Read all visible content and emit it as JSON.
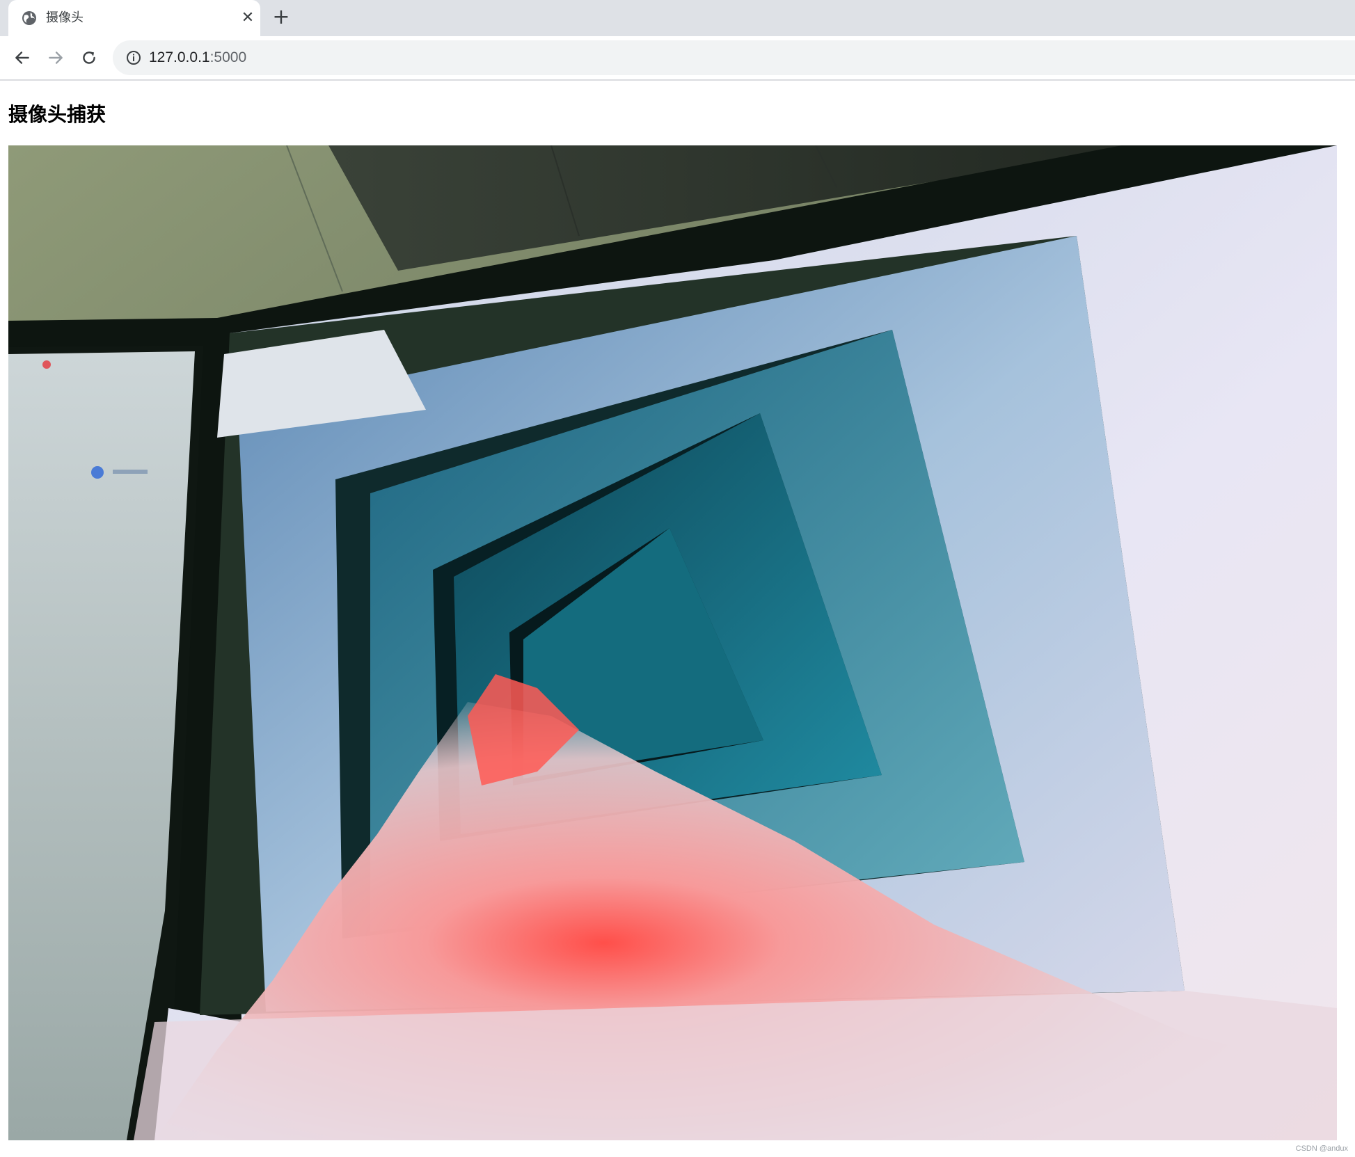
{
  "browser": {
    "tab": {
      "title": "摄像头",
      "close_glyph": "✕",
      "favicon": "globe-icon"
    },
    "new_tab_glyph": "+",
    "address": {
      "host": "127.0.0.1",
      "port": ":5000",
      "icon": "info-icon"
    }
  },
  "page": {
    "heading": "摄像头捕获"
  },
  "watermark": "CSDN @andux"
}
